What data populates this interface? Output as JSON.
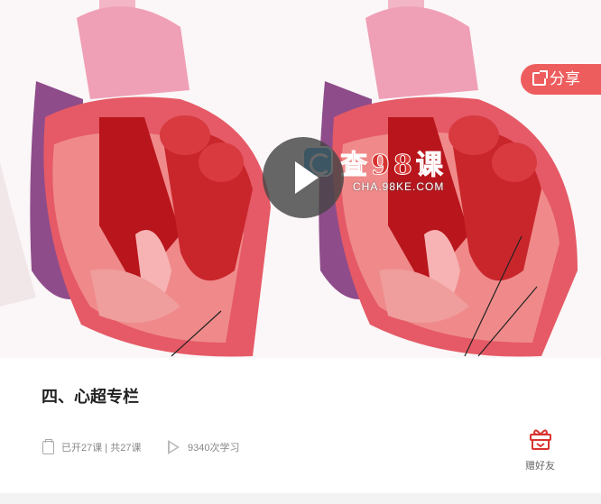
{
  "cover": {
    "watermark_text": "查98课",
    "watermark_url": "CHA.98KE.COM"
  },
  "share": {
    "label": "分享"
  },
  "course": {
    "title": "四、心超专栏",
    "lessons_text": "已开27课 | 共27课",
    "plays_text": "9340次学习"
  },
  "gift": {
    "label": "赠好友"
  },
  "colors": {
    "accent": "#ee5d5d",
    "gift": "#d9332f"
  },
  "icons": [
    "play-icon",
    "share-icon",
    "calendar-icon",
    "play-count-icon",
    "gift-icon"
  ]
}
